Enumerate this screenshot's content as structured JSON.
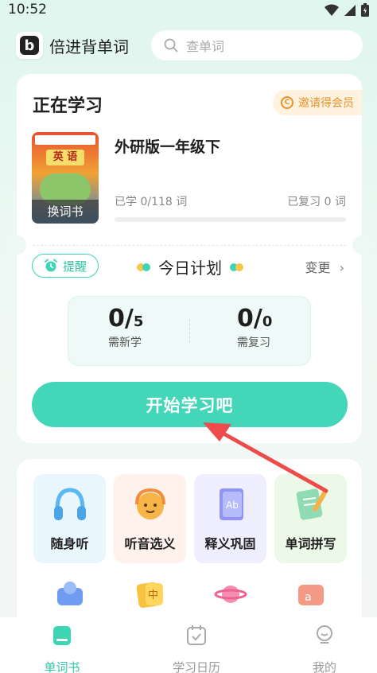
{
  "status_bar": {
    "time": "10:52"
  },
  "header": {
    "app_name": "倍进背单词",
    "logo_letter": "b",
    "search_placeholder": "查单词"
  },
  "current": {
    "title": "正在学习",
    "invite_label": "邀请得会员",
    "cover_title": "英 语",
    "change_book_label": "换词书",
    "book_name": "外研版一年级下",
    "learned_text": "已学 0/118 词",
    "reviewed_text": "已复习 0 词",
    "progress_fraction": 0
  },
  "plan": {
    "remind_label": "提醒",
    "title": "今日计划",
    "change_label": "变更",
    "new": {
      "done": "0",
      "total": "5",
      "label": "需新学"
    },
    "review": {
      "done": "0",
      "total": "0",
      "label": "需复习"
    },
    "start_label": "开始学习吧"
  },
  "tools": [
    {
      "label": "随身听",
      "icon": "headphones-icon",
      "bg": "#e9f6fe"
    },
    {
      "label": "听音选义",
      "icon": "listen-choose-icon",
      "bg": "#fff1ec"
    },
    {
      "label": "释义巩固",
      "icon": "definition-book-icon",
      "bg": "#efeefe"
    },
    {
      "label": "单词拼写",
      "icon": "spelling-notebook-icon",
      "bg": "#edf9e8"
    }
  ],
  "tabs": [
    {
      "label": "单词书",
      "active": true
    },
    {
      "label": "学习日历",
      "active": false
    },
    {
      "label": "我的",
      "active": false
    }
  ],
  "colors": {
    "accent": "#43d6b9",
    "invite": "#e7922e",
    "arrow": "#ee4b4b"
  }
}
